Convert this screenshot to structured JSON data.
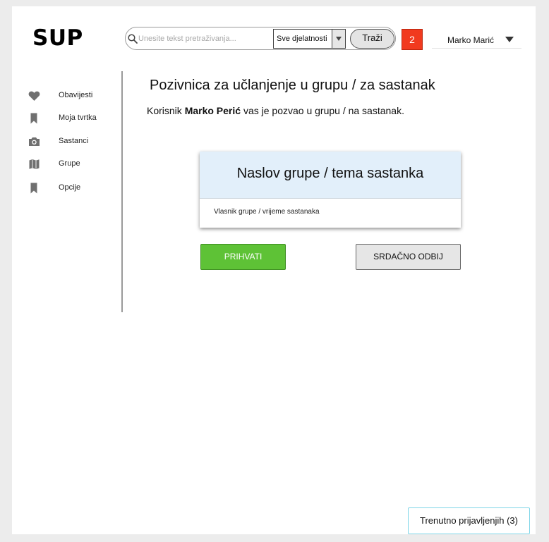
{
  "header": {
    "logo": "SUP",
    "search": {
      "placeholder": "Unesite tekst pretraživanja...",
      "value": ""
    },
    "category_select": {
      "selected": "Sve djelatnosti"
    },
    "search_button": "Traži",
    "notification_count": "2",
    "user_name": "Marko Marić"
  },
  "sidebar": {
    "items": [
      {
        "label": "Obavijesti",
        "icon": "heart-icon"
      },
      {
        "label": "Moja tvrtka",
        "icon": "bookmark-icon"
      },
      {
        "label": "Sastanci",
        "icon": "camera-icon"
      },
      {
        "label": "Grupe",
        "icon": "map-icon"
      },
      {
        "label": "Opcije",
        "icon": "bookmark-icon"
      }
    ]
  },
  "main": {
    "title": "Pozivnica za učlanjenje u grupu / za sastanak",
    "invite_prefix": "Korisnik ",
    "inviter_name": "Marko Perić",
    "invite_suffix": " vas je pozvao u grupu / na sastanak.",
    "card": {
      "title": "Naslov grupe / tema sastanka",
      "subtitle": "Vlasnik grupe / vrijeme sastanaka"
    },
    "accept_button": "PRIHVATI",
    "decline_button": "SRDAČNO ODBIJ"
  },
  "footer": {
    "online_users": "Trenutno prijavljenjih (3)"
  },
  "colors": {
    "accept": "#5ec236",
    "notification": "#f13a1f",
    "card_header": "#e2effa",
    "online_border": "#7fd6e8"
  }
}
